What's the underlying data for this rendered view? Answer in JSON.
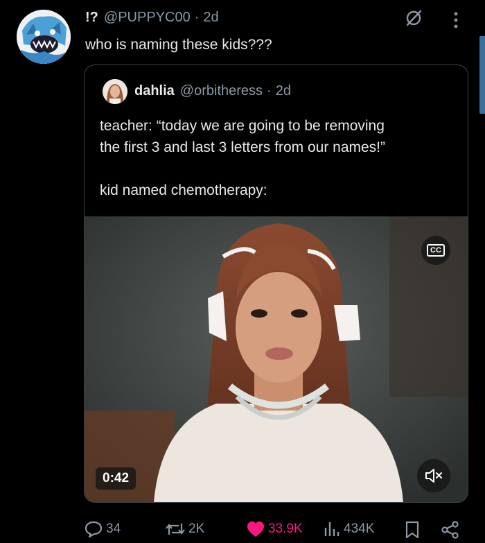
{
  "post": {
    "display_name": "!?",
    "handle": "@PUPPYC00",
    "separator": "·",
    "time": "2d",
    "text": "who is naming these kids???"
  },
  "quoted_post": {
    "display_name": "dahlia",
    "handle": "@orbitheress",
    "separator": "·",
    "time": "2d",
    "lines": [
      "teacher: “today we are going to be removing",
      "the first 3 and last 3 letters from our names!”",
      "",
      "kid named chemotherapy:"
    ],
    "video": {
      "timestamp": "0:42",
      "captions_label": "CC"
    }
  },
  "actions": {
    "replies": "34",
    "reposts": "2K",
    "likes": "33.9K",
    "views": "434K"
  },
  "icons": [
    "grok-icon",
    "more-icon",
    "cc-icon",
    "mute-icon",
    "reply-icon",
    "repost-icon",
    "like-icon",
    "views-icon",
    "bookmark-icon",
    "share-icon"
  ],
  "colors": {
    "background": "#000000",
    "text": "#e7e9ea",
    "muted": "#8b98a5",
    "like": "#f91880",
    "border": "#3e4144"
  }
}
